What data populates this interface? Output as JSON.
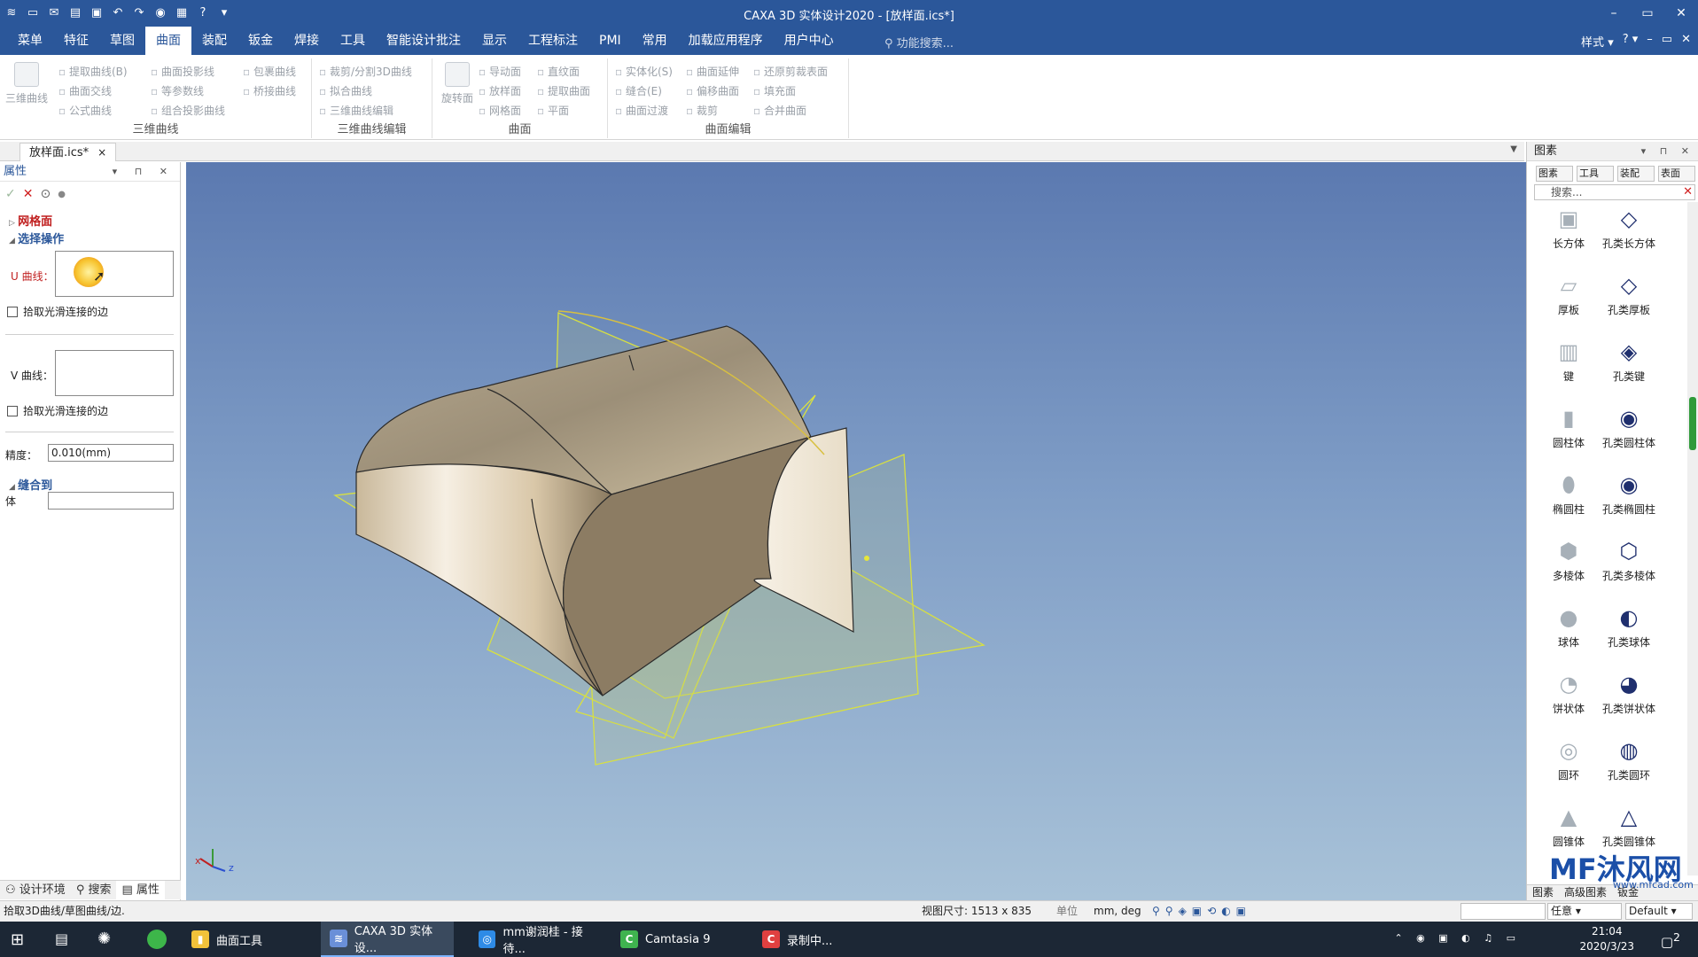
{
  "app": {
    "title": "CAXA 3D 实体设计2020 - [放样面.ics*]",
    "window_controls": [
      "–",
      "▭",
      "✕"
    ]
  },
  "menubar": {
    "tabs": [
      "菜单",
      "特征",
      "草图",
      "曲面",
      "装配",
      "钣金",
      "焊接",
      "工具",
      "智能设计批注",
      "显示",
      "工程标注",
      "PMI",
      "常用",
      "加载应用程序",
      "用户中心"
    ],
    "active_tab": "曲面",
    "search_placeholder": "功能搜索...",
    "style_label": "样式",
    "win_min": "–",
    "win_restore": "▭",
    "win_close": "✕"
  },
  "ribbon": {
    "groups": [
      {
        "label": "三维曲线",
        "big": "三维曲线",
        "items": [
          "提取曲线(B)",
          "曲面投影线",
          "包裹曲线",
          "曲面交线",
          "等参数线",
          "桥接曲线",
          "公式曲线",
          "组合投影曲线"
        ]
      },
      {
        "label": "三维曲线编辑",
        "items": [
          "裁剪/分割3D曲线",
          "拟合曲线",
          "三维曲线编辑"
        ]
      },
      {
        "label": "曲面",
        "big": "旋转面",
        "items": [
          "导动面",
          "直纹面",
          "放样面",
          "提取曲面",
          "网格面",
          "平面"
        ]
      },
      {
        "label": "曲面编辑",
        "items": [
          "实体化(S)",
          "曲面延伸",
          "还原剪裁表面",
          "缝合(E)",
          "偏移曲面",
          "填充面",
          "曲面过渡",
          "裁剪",
          "合并曲面"
        ]
      }
    ]
  },
  "doc_tab": {
    "label": "放样面.ics*",
    "close": "×"
  },
  "properties": {
    "header": "属性",
    "sections": {
      "mesh": "网格面",
      "select_op": "选择操作",
      "sew_to": "缝合到"
    },
    "u_curve_label": "U 曲线：",
    "v_curve_label": "V 曲线：",
    "pick_smooth_1": "拾取光滑连接的边",
    "pick_smooth_2": "拾取光滑连接的边",
    "precision_label": "精度：",
    "precision_value": "0.010(mm)",
    "body_label": "体",
    "bottom_tabs": [
      "设计环境",
      "搜索",
      "属性"
    ]
  },
  "library": {
    "header": "图素",
    "tabs": [
      "图素",
      "工具",
      "装配",
      "表面"
    ],
    "search_placeholder": "搜索...",
    "items": [
      {
        "name": "长方体",
        "icon": "box-icon"
      },
      {
        "name": "孔类长方体",
        "icon": "box-hole-icon"
      },
      {
        "name": "厚板",
        "icon": "plate-icon"
      },
      {
        "name": "孔类厚板",
        "icon": "plate-hole-icon"
      },
      {
        "name": "键",
        "icon": "key-icon"
      },
      {
        "name": "孔类键",
        "icon": "key-hole-icon"
      },
      {
        "name": "圆柱体",
        "icon": "cylinder-icon"
      },
      {
        "name": "孔类圆柱体",
        "icon": "cylinder-hole-icon"
      },
      {
        "name": "椭圆柱",
        "icon": "ellipse-cylinder-icon"
      },
      {
        "name": "孔类椭圆柱",
        "icon": "ellipse-cylinder-hole-icon"
      },
      {
        "name": "多棱体",
        "icon": "prism-icon"
      },
      {
        "name": "孔类多棱体",
        "icon": "prism-hole-icon"
      },
      {
        "name": "球体",
        "icon": "sphere-icon"
      },
      {
        "name": "孔类球体",
        "icon": "sphere-hole-icon"
      },
      {
        "name": "饼状体",
        "icon": "pie-icon"
      },
      {
        "name": "孔类饼状体",
        "icon": "pie-hole-icon"
      },
      {
        "name": "圆环",
        "icon": "torus-icon"
      },
      {
        "name": "孔类圆环",
        "icon": "torus-hole-icon"
      },
      {
        "name": "圆锥体",
        "icon": "cone-icon"
      },
      {
        "name": "孔类圆锥体",
        "icon": "cone-hole-icon"
      }
    ],
    "bottom_tabs": [
      "图素",
      "高级图素",
      "钣金"
    ]
  },
  "watermark": {
    "logo": "沐风网",
    "url": "www.mfcad.com"
  },
  "status": {
    "message": "拾取3D曲线/草图曲线/边.",
    "view_size": "视图尺寸: 1513 x  835",
    "unit_label": "单位",
    "unit_value": "mm, deg",
    "select_mode": "任意",
    "style": "Default"
  },
  "taskbar": {
    "apps": [
      {
        "label": "曲面工具",
        "icon": "folder-icon",
        "color": "#f2c23a"
      },
      {
        "label": "CAXA 3D 实体设...",
        "icon": "caxa-icon",
        "color": "#6a8fd8"
      },
      {
        "label": "mm谢润桂 - 接待...",
        "icon": "chat-icon",
        "color": "#2e8be6"
      },
      {
        "label": "Camtasia 9",
        "icon": "camtasia-icon",
        "color": "#3fb34f"
      },
      {
        "label": "录制中...",
        "icon": "record-icon",
        "color": "#e04040"
      }
    ],
    "time": "21:04",
    "date": "2020/3/23",
    "notify_count": "2"
  },
  "colors": {
    "accent": "#2b579a",
    "warn": "#d02020",
    "viewport_top": "#5b79b0",
    "viewport_bottom": "#a8c2d8"
  }
}
